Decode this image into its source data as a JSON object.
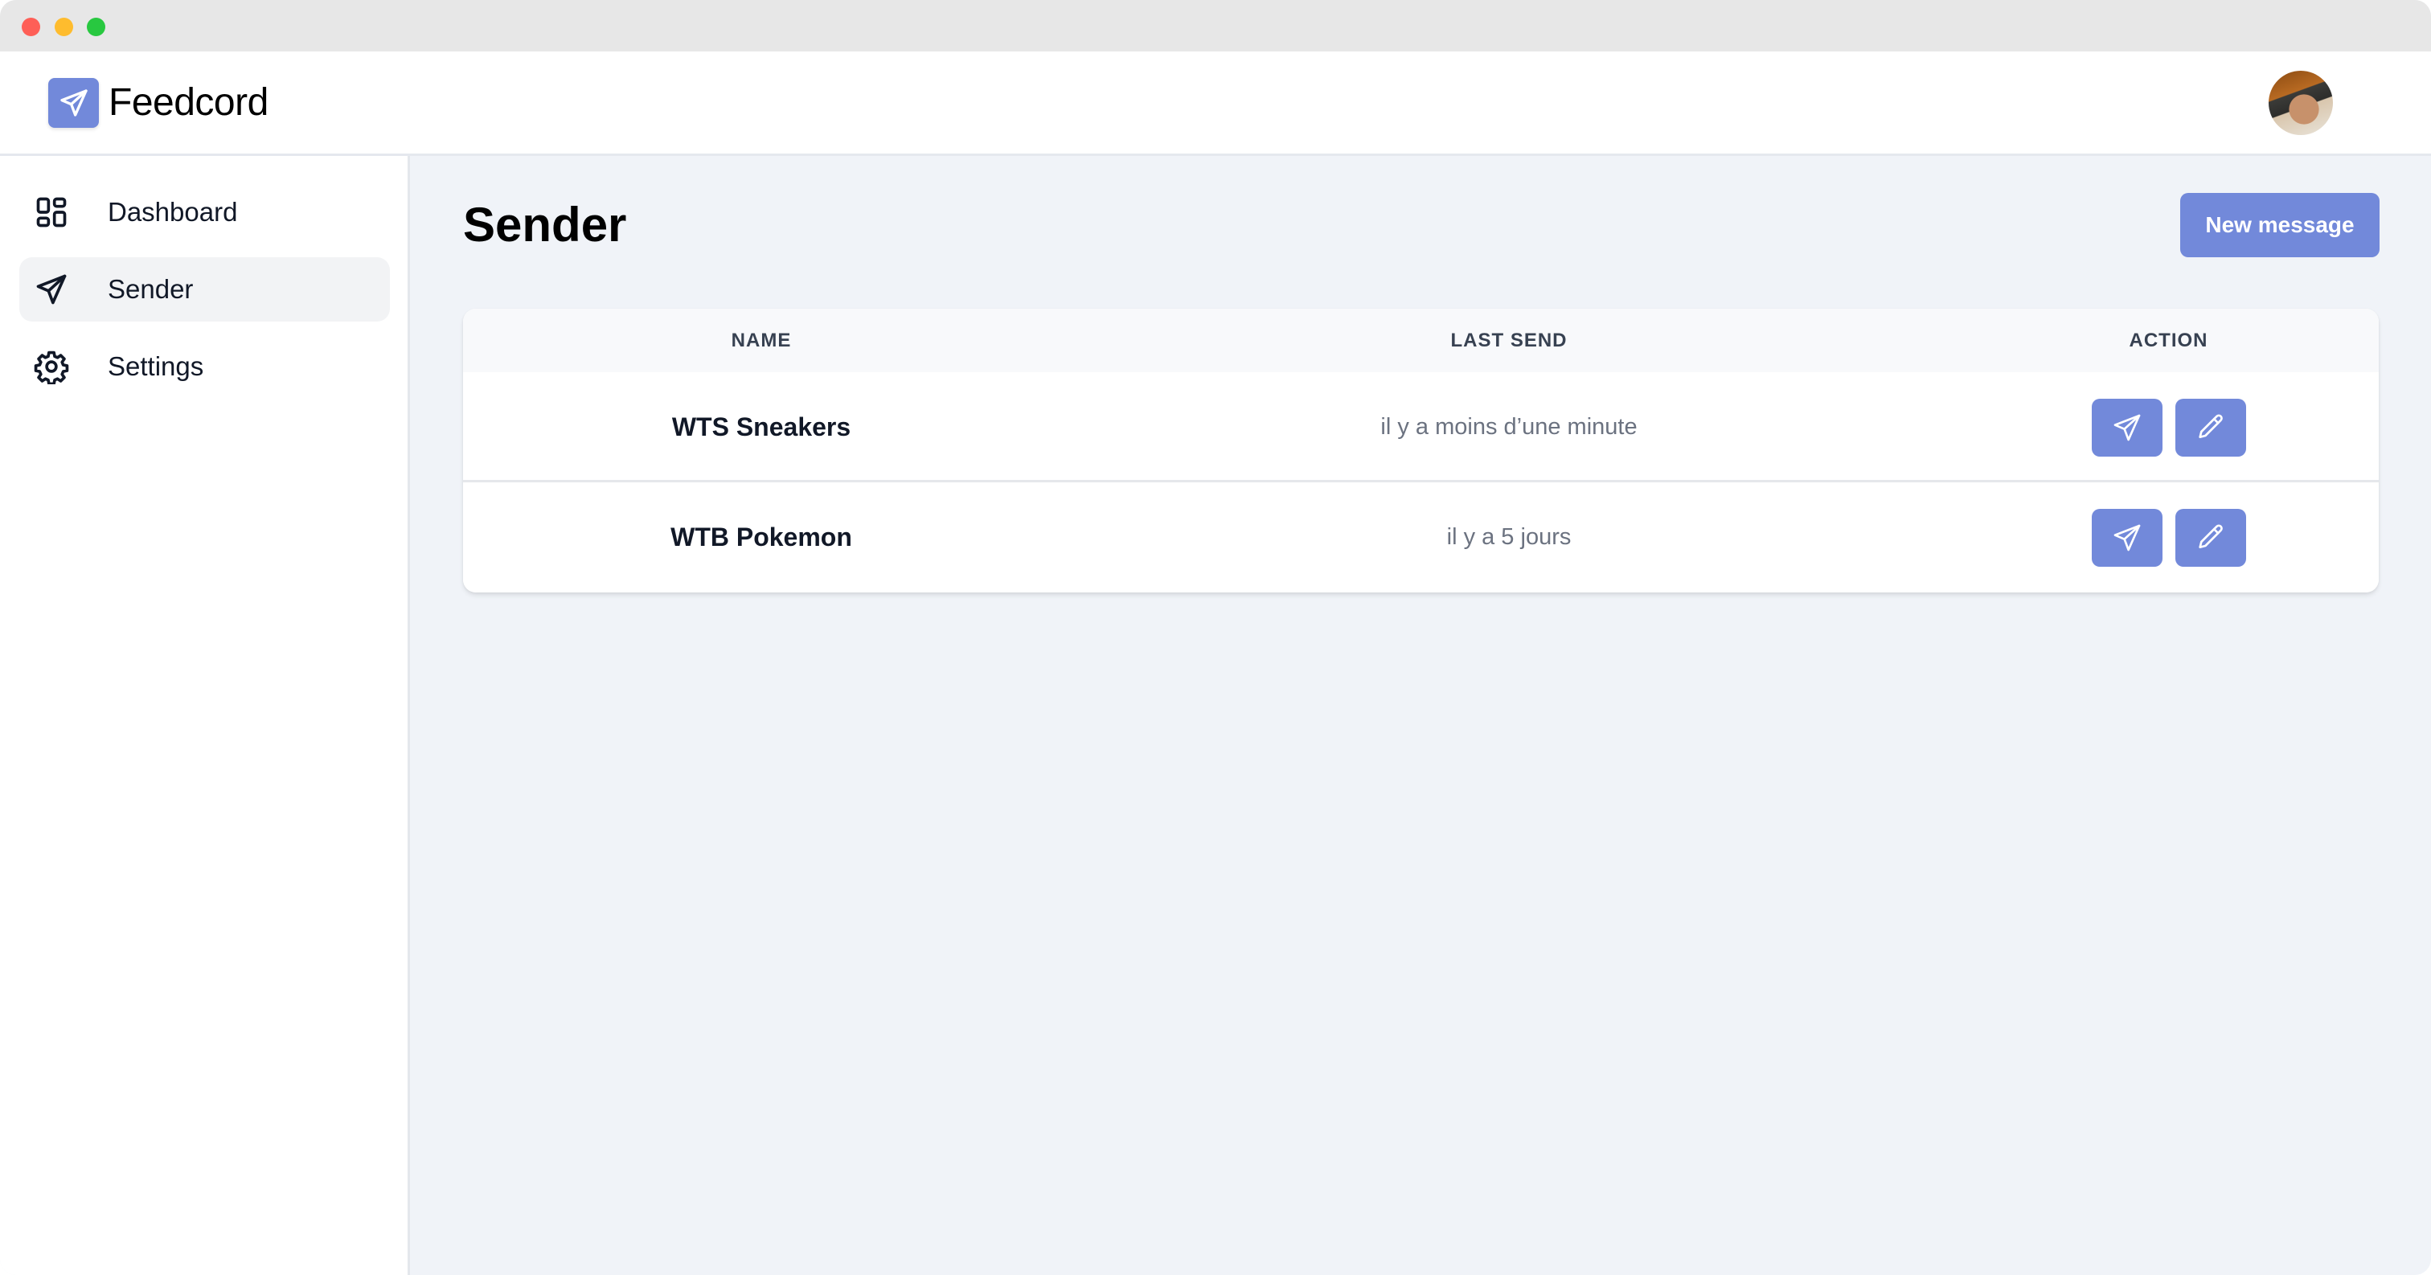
{
  "window": {
    "controls": [
      "close",
      "minimize",
      "maximize"
    ]
  },
  "header": {
    "brand": "Feedcord",
    "logo_icon": "paper-plane-icon",
    "avatar_alt": "User avatar"
  },
  "sidebar": {
    "items": [
      {
        "label": "Dashboard",
        "icon": "dashboard-grid-icon",
        "active": false
      },
      {
        "label": "Sender",
        "icon": "paper-plane-icon",
        "active": true
      },
      {
        "label": "Settings",
        "icon": "gear-icon",
        "active": false
      }
    ]
  },
  "main": {
    "title": "Sender",
    "new_button_label": "New message",
    "table": {
      "columns": [
        "NAME",
        "LAST SEND",
        "ACTION"
      ],
      "rows": [
        {
          "name": "WTS Sneakers",
          "last_send": "il y a moins d’une minute",
          "actions": [
            "send-icon",
            "edit-pencil-icon"
          ]
        },
        {
          "name": "WTB Pokemon",
          "last_send": "il y a 5 jours",
          "actions": [
            "send-icon",
            "edit-pencil-icon"
          ]
        }
      ]
    }
  },
  "colors": {
    "accent": "#7289da",
    "background": "#f0f3f8",
    "sidebar_active": "#f2f3f5",
    "text_primary": "#111827",
    "text_muted": "#6b7280"
  }
}
